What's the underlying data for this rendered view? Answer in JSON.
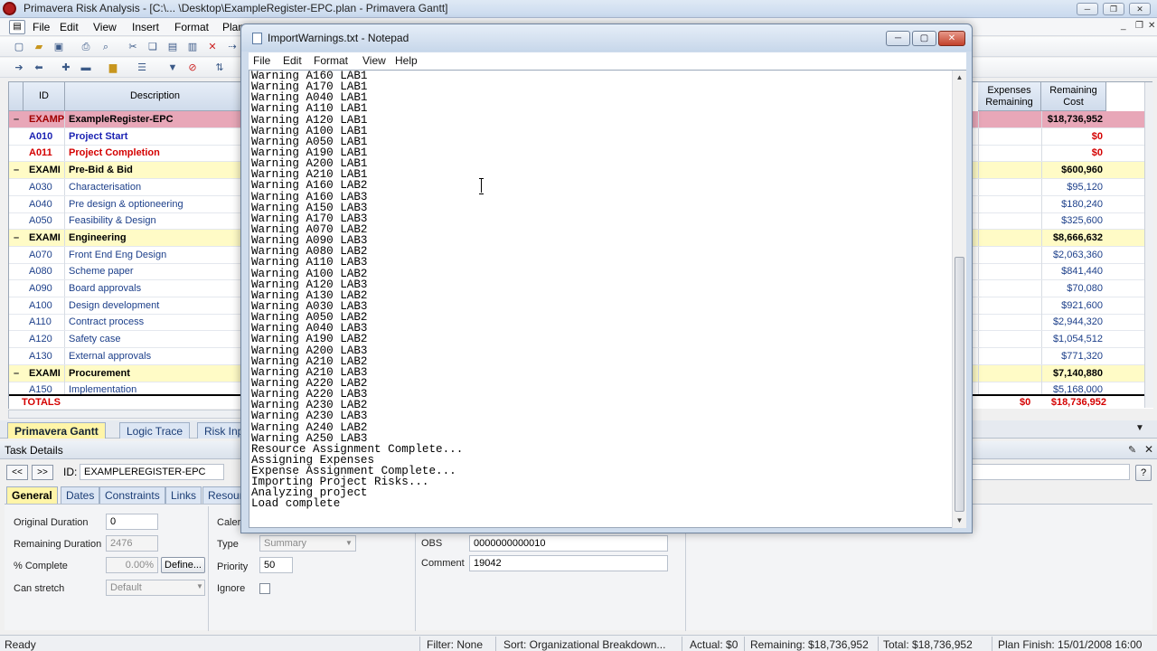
{
  "app": {
    "title": "Primavera Risk Analysis - [C:\\... \\Desktop\\ExampleRegister-EPC.plan - Primavera Gantt]",
    "menu": [
      "File",
      "Edit",
      "View",
      "Insert",
      "Format",
      "Plan"
    ]
  },
  "grid": {
    "headers": {
      "id": "ID",
      "description": "Description",
      "expenses_remaining": "Expenses Remaining",
      "remaining_cost": "Remaining Cost"
    },
    "rows": [
      {
        "type": "project",
        "sel": "–",
        "id": "EXAMPI",
        "desc": "ExampleRegister-EPC",
        "cost": "$18,736,952"
      },
      {
        "type": "milestone",
        "sel": "",
        "id": "A010",
        "desc": "Project Start",
        "cost": "$0"
      },
      {
        "type": "milestone red",
        "sel": "",
        "id": "A011",
        "desc": "Project Completion",
        "cost": "$0"
      },
      {
        "type": "wbs",
        "sel": "–",
        "id": "EXAMI",
        "desc": "Pre-Bid & Bid",
        "cost": "$600,960"
      },
      {
        "type": "task",
        "sel": "",
        "id": "A030",
        "desc": "Characterisation",
        "cost": "$95,120"
      },
      {
        "type": "task",
        "sel": "",
        "id": "A040",
        "desc": "Pre design & optioneering",
        "cost": "$180,240"
      },
      {
        "type": "task",
        "sel": "",
        "id": "A050",
        "desc": "Feasibility & Design",
        "cost": "$325,600"
      },
      {
        "type": "wbs",
        "sel": "–",
        "id": "EXAMI",
        "desc": "Engineering",
        "cost": "$8,666,632"
      },
      {
        "type": "task",
        "sel": "",
        "id": "A070",
        "desc": "Front End Eng Design",
        "cost": "$2,063,360"
      },
      {
        "type": "task",
        "sel": "",
        "id": "A080",
        "desc": "Scheme paper",
        "cost": "$841,440"
      },
      {
        "type": "task",
        "sel": "",
        "id": "A090",
        "desc": "Board approvals",
        "cost": "$70,080"
      },
      {
        "type": "task",
        "sel": "",
        "id": "A100",
        "desc": "Design development",
        "cost": "$921,600"
      },
      {
        "type": "task",
        "sel": "",
        "id": "A110",
        "desc": "Contract process",
        "cost": "$2,944,320"
      },
      {
        "type": "task",
        "sel": "",
        "id": "A120",
        "desc": "Safety case",
        "cost": "$1,054,512"
      },
      {
        "type": "task",
        "sel": "",
        "id": "A130",
        "desc": "External approvals",
        "cost": "$771,320"
      },
      {
        "type": "wbs",
        "sel": "–",
        "id": "EXAMI",
        "desc": "Procurement",
        "cost": "$7,140,880"
      },
      {
        "type": "task",
        "sel": "",
        "id": "A150",
        "desc": "Implementation",
        "cost": "$5,168,000"
      }
    ],
    "totals": {
      "label": "TOTALS",
      "expenses": "$0",
      "cost": "$18,736,952"
    }
  },
  "gantt_tabs": [
    "Primavera Gantt",
    "Logic Trace",
    "Risk Inp"
  ],
  "task_details": {
    "title": "Task Details",
    "prev": "<<",
    "next": ">>",
    "id_label": "ID:",
    "id_value": "EXAMPLEREGISTER-EPC",
    "help": "?",
    "tabs": [
      "General",
      "Dates",
      "Constraints",
      "Links",
      "Resour"
    ],
    "fields": {
      "original_duration_label": "Original Duration",
      "original_duration": "0",
      "remaining_duration_label": "Remaining Duration",
      "remaining_duration": "2476",
      "percent_complete_label": "% Complete",
      "percent_complete": "0.00%",
      "define_button": "Define...",
      "can_stretch_label": "Can stretch",
      "can_stretch": "Default",
      "calendar_label": "Caler",
      "type_label": "Type",
      "type": "Summary",
      "priority_label": "Priority",
      "priority": "50",
      "ignore_label": "Ignore",
      "obs_label": "OBS",
      "obs": "0000000000010",
      "comment_label": "Comment",
      "comment": "19042"
    }
  },
  "status_bar": {
    "ready": "Ready",
    "filter": "Filter: None",
    "sort": "Sort: Organizational Breakdown...",
    "actual": "Actual: $0",
    "remaining": "Remaining: $18,736,952",
    "total": "Total: $18,736,952",
    "plan_finish": "Plan Finish: 15/01/2008 16:00"
  },
  "notepad": {
    "title": "ImportWarnings.txt - Notepad",
    "menu": [
      "File",
      "Edit",
      "Format",
      "View",
      "Help"
    ],
    "lines": [
      "Warning A160 LAB1",
      "Warning A170 LAB1",
      "Warning A040 LAB1",
      "Warning A110 LAB1",
      "Warning A120 LAB1",
      "Warning A100 LAB1",
      "Warning A050 LAB1",
      "Warning A190 LAB1",
      "Warning A200 LAB1",
      "Warning A210 LAB1",
      "Warning A160 LAB2",
      "Warning A160 LAB3",
      "Warning A150 LAB3",
      "Warning A170 LAB3",
      "Warning A070 LAB2",
      "Warning A090 LAB3",
      "Warning A080 LAB2",
      "Warning A110 LAB3",
      "Warning A100 LAB2",
      "Warning A120 LAB3",
      "Warning A130 LAB2",
      "Warning A030 LAB3",
      "Warning A050 LAB2",
      "Warning A040 LAB3",
      "Warning A190 LAB2",
      "Warning A200 LAB3",
      "Warning A210 LAB2",
      "Warning A210 LAB3",
      "Warning A220 LAB2",
      "Warning A220 LAB3",
      "Warning A230 LAB2",
      "Warning A230 LAB3",
      "Warning A240 LAB2",
      "Warning A250 LAB3",
      "Resource Assignment Complete...",
      "Assigning Expenses",
      "Expense Assignment Complete...",
      "Importing Project Risks...",
      "Analyzing project",
      "Load complete"
    ]
  }
}
